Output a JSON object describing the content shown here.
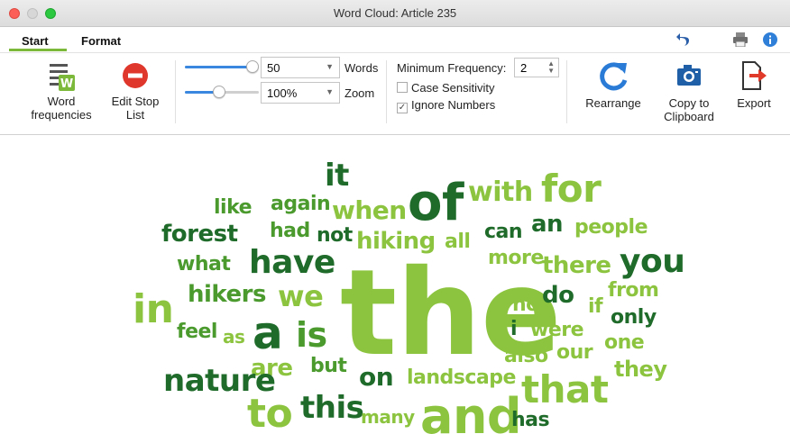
{
  "window": {
    "title": "Word Cloud: Article 235"
  },
  "tabs": [
    {
      "label": "Start",
      "active": true
    },
    {
      "label": "Format",
      "active": false
    }
  ],
  "toolbar_right": {
    "undo_icon": "undo-icon",
    "print_icon": "printer-icon",
    "info_icon": "info-icon"
  },
  "ribbon": {
    "word_frequencies": "Word\nfrequencies",
    "edit_stop_list": "Edit Stop\nList",
    "words_slider": {
      "value": 50,
      "fill": 1.0
    },
    "words_select": "50",
    "words_label": "Words",
    "zoom_slider": {
      "fill": 0.45
    },
    "zoom_select": "100%",
    "zoom_label": "Zoom",
    "min_freq_label": "Minimum Frequency:",
    "min_freq_value": "2",
    "case_sensitivity": {
      "label": "Case Sensitivity",
      "checked": false
    },
    "ignore_numbers": {
      "label": "Ignore Numbers",
      "checked": true
    },
    "rearrange": "Rearrange",
    "copy_clipboard": "Copy to\nClipboard",
    "export": "Export"
  },
  "colors": {
    "dark": "#1f6b2a",
    "mid": "#4a9a2e",
    "light": "#8cc43f",
    "accent": "#7cb83a"
  },
  "cloud": {
    "words": [
      {
        "text": "it",
        "tone": "dark"
      },
      {
        "text": "of",
        "tone": "dark"
      },
      {
        "text": "with",
        "tone": "light"
      },
      {
        "text": "for",
        "tone": "light"
      },
      {
        "text": "like",
        "tone": "mid"
      },
      {
        "text": "again",
        "tone": "mid"
      },
      {
        "text": "when",
        "tone": "light"
      },
      {
        "text": "an",
        "tone": "dark"
      },
      {
        "text": "forest",
        "tone": "dark"
      },
      {
        "text": "had",
        "tone": "mid"
      },
      {
        "text": "not",
        "tone": "dark"
      },
      {
        "text": "hiking",
        "tone": "light"
      },
      {
        "text": "all",
        "tone": "light"
      },
      {
        "text": "can",
        "tone": "dark"
      },
      {
        "text": "people",
        "tone": "light"
      },
      {
        "text": "what",
        "tone": "mid"
      },
      {
        "text": "have",
        "tone": "dark"
      },
      {
        "text": "more",
        "tone": "light"
      },
      {
        "text": "there",
        "tone": "light"
      },
      {
        "text": "you",
        "tone": "dark"
      },
      {
        "text": "in",
        "tone": "light"
      },
      {
        "text": "hikers",
        "tone": "mid"
      },
      {
        "text": "we",
        "tone": "light"
      },
      {
        "text": "the",
        "tone": "light"
      },
      {
        "text": "no",
        "tone": "light"
      },
      {
        "text": "do",
        "tone": "dark"
      },
      {
        "text": "from",
        "tone": "light"
      },
      {
        "text": "if",
        "tone": "light"
      },
      {
        "text": "only",
        "tone": "dark"
      },
      {
        "text": "feel",
        "tone": "mid"
      },
      {
        "text": "as",
        "tone": "light"
      },
      {
        "text": "a",
        "tone": "dark"
      },
      {
        "text": "is",
        "tone": "mid"
      },
      {
        "text": "i",
        "tone": "dark"
      },
      {
        "text": "were",
        "tone": "light"
      },
      {
        "text": "one",
        "tone": "light"
      },
      {
        "text": "also",
        "tone": "light"
      },
      {
        "text": "our",
        "tone": "light"
      },
      {
        "text": "they",
        "tone": "light"
      },
      {
        "text": "are",
        "tone": "light"
      },
      {
        "text": "but",
        "tone": "mid"
      },
      {
        "text": "nature",
        "tone": "dark"
      },
      {
        "text": "on",
        "tone": "dark"
      },
      {
        "text": "landscape",
        "tone": "light"
      },
      {
        "text": "that",
        "tone": "light"
      },
      {
        "text": "to",
        "tone": "light"
      },
      {
        "text": "this",
        "tone": "dark"
      },
      {
        "text": "many",
        "tone": "light"
      },
      {
        "text": "and",
        "tone": "light"
      },
      {
        "text": "has",
        "tone": "dark"
      }
    ]
  }
}
